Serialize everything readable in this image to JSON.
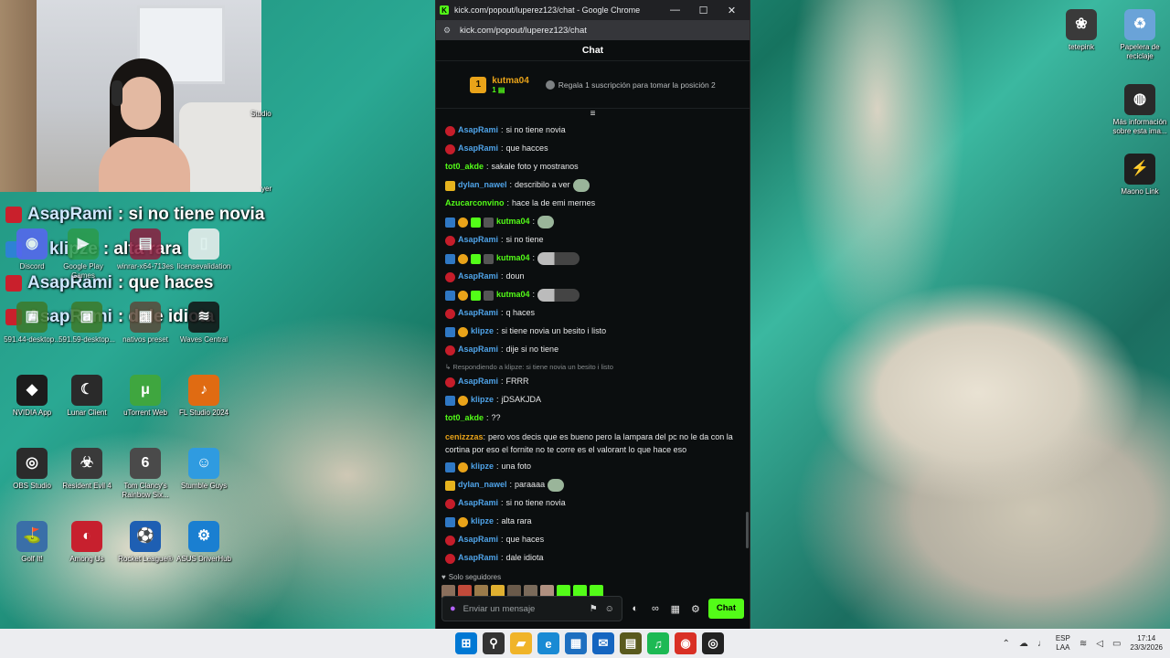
{
  "webcam": {
    "alt": "webcam"
  },
  "overlay_chat": [
    {
      "user": "AsapRami",
      "text": ": si no tiene novia",
      "badge": "red"
    },
    {
      "user": "klipze",
      "text": ": alta rara",
      "badge": "blue"
    },
    {
      "user": "AsapRami",
      "text": ": que haces",
      "badge": "red"
    },
    {
      "user": "AsapRami",
      "text": ": dale idiota",
      "badge": "red"
    }
  ],
  "desktop_icons_left": [
    {
      "label": "Discord",
      "color": "#5865f2",
      "glyph": "◉"
    },
    {
      "label": "Google Play Games",
      "color": "#2b9a4a",
      "glyph": "▶"
    },
    {
      "label": "winrar-x64-713es",
      "color": "#8b1e3f",
      "glyph": "▤"
    },
    {
      "label": "licensevalidation",
      "color": "#f1f1f1",
      "glyph": "▯"
    },
    {
      "label": "591.44-desktop...",
      "color": "#3d7a2a",
      "glyph": "▣"
    },
    {
      "label": "591.59-desktop...",
      "color": "#3d7a2a",
      "glyph": "▣"
    },
    {
      "label": "nativos preset",
      "color": "#5b4a3a",
      "glyph": "▦"
    },
    {
      "label": "Waves Central",
      "color": "#111111",
      "glyph": "≋"
    },
    {
      "label": "NVIDIA App",
      "color": "#1c1c1c",
      "glyph": "◆"
    },
    {
      "label": "Lunar Client",
      "color": "#2a2a2a",
      "glyph": "☾"
    },
    {
      "label": "uTorrent Web",
      "color": "#3fa63f",
      "glyph": "μ"
    },
    {
      "label": "FL Studio 2024",
      "color": "#e06b12",
      "glyph": "♪"
    },
    {
      "label": "OBS Studio",
      "color": "#2b2b2b",
      "glyph": "◎"
    },
    {
      "label": "Resident Evil 4",
      "color": "#3a3a3a",
      "glyph": "☣"
    },
    {
      "label": "Tom Clancy's Rainbow Six...",
      "color": "#4a4a4a",
      "glyph": "6"
    },
    {
      "label": "Stumble Guys",
      "color": "#2f9be0",
      "glyph": "☺"
    },
    {
      "label": "Golf It!",
      "color": "#3a6fa8",
      "glyph": "⛳"
    },
    {
      "label": "Among Us",
      "color": "#c7202e",
      "glyph": "◐"
    },
    {
      "label": "Rocket League®",
      "color": "#1e5fb3",
      "glyph": "⚽"
    },
    {
      "label": "ASUS DriverHub",
      "color": "#1a7fd1",
      "glyph": "⚙"
    }
  ],
  "desktop_partial": [
    {
      "label": "Studio"
    },
    {
      "label": "yer"
    }
  ],
  "desktop_icons_right": [
    {
      "label": "tetepink",
      "color": "#3a3a3a",
      "glyph": "❀"
    },
    {
      "label": "Papelera de reciclaje",
      "color": "#6aa3d8",
      "glyph": "♻"
    },
    {
      "label": "Más información sobre esta ima...",
      "color": "#2a2a2a",
      "glyph": "◍"
    },
    {
      "label": "Maono Link",
      "color": "#1f1f1f",
      "glyph": "⚡"
    }
  ],
  "browser": {
    "title": "kick.com/popout/luperez123/chat - Google Chrome",
    "url": "kick.com/popout/luperez123/chat",
    "minimize": "—",
    "maximize": "☐",
    "close": "✕"
  },
  "chat": {
    "header": "Chat",
    "pinned": {
      "rank": "1",
      "user": "kutma04",
      "sub": "1 ▤",
      "gift_text": "Regala 1 suscripción para tomar la posición 2"
    },
    "toggle": "≡",
    "reply_note": "↳ Respondiendo a klipze: si tiene novia un besito i listo",
    "messages": [
      {
        "badges": [
          "redcircle"
        ],
        "user": "AsapRami",
        "color": "#4fa3e8",
        "text": "si no tiene novia"
      },
      {
        "badges": [
          "redcircle"
        ],
        "user": "AsapRami",
        "color": "#4fa3e8",
        "text": "que hacces"
      },
      {
        "badges": [],
        "user": "tot0_akde",
        "color": "#53fc18",
        "text": "sakale foto y mostranos"
      },
      {
        "badges": [
          "crown"
        ],
        "user": "dylan_nawel",
        "color": "#4fa3e8",
        "text": "describilo a ver",
        "emote": "face"
      },
      {
        "badges": [],
        "user": "Azucarconvino",
        "color": "#53fc18",
        "text": "hace la de emi mernes"
      },
      {
        "badges": [
          "blue",
          "orange",
          "green",
          "gray"
        ],
        "user": "kutma04",
        "color": "#53fc18",
        "text": "",
        "emote": "face"
      },
      {
        "badges": [
          "redcircle"
        ],
        "user": "AsapRami",
        "color": "#4fa3e8",
        "text": "si no tiene"
      },
      {
        "badges": [
          "blue",
          "orange",
          "green",
          "gray"
        ],
        "user": "kutma04",
        "color": "#53fc18",
        "text": "",
        "emote": "wide"
      },
      {
        "badges": [
          "redcircle"
        ],
        "user": "AsapRami",
        "color": "#4fa3e8",
        "text": "doun"
      },
      {
        "badges": [
          "blue",
          "orange",
          "green",
          "gray"
        ],
        "user": "kutma04",
        "color": "#53fc18",
        "text": "",
        "emote": "wide"
      },
      {
        "badges": [
          "redcircle"
        ],
        "user": "AsapRami",
        "color": "#4fa3e8",
        "text": "q haces"
      },
      {
        "badges": [
          "blue",
          "orange"
        ],
        "user": "klipze",
        "color": "#4fa3e8",
        "text": "si tiene novia un besito i listo"
      },
      {
        "badges": [
          "redcircle"
        ],
        "user": "AsapRami",
        "color": "#4fa3e8",
        "text": "dije si no tiene"
      }
    ],
    "messages_after_reply": [
      {
        "badges": [
          "redcircle"
        ],
        "user": "AsapRami",
        "color": "#4fa3e8",
        "text": "FRRR"
      },
      {
        "badges": [
          "blue",
          "orange"
        ],
        "user": "klipze",
        "color": "#4fa3e8",
        "text": "jDSAKJDA"
      },
      {
        "badges": [],
        "user": "tot0_akde",
        "color": "#53fc18",
        "text": "??"
      },
      {
        "badges": [],
        "user": "cenizzzas",
        "color": "#e9a319",
        "text": "pero vos decis que es bueno pero la lampara del pc no le da con la cortina por eso el fornite no te corre es el valorant lo que hace eso",
        "multi": true
      },
      {
        "badges": [
          "blue",
          "orange"
        ],
        "user": "klipze",
        "color": "#4fa3e8",
        "text": "una foto"
      },
      {
        "badges": [
          "crown"
        ],
        "user": "dylan_nawel",
        "color": "#4fa3e8",
        "text": "paraaaa",
        "emote": "face"
      },
      {
        "badges": [
          "redcircle"
        ],
        "user": "AsapRami",
        "color": "#4fa3e8",
        "text": "si no tiene novia"
      },
      {
        "badges": [
          "blue",
          "orange"
        ],
        "user": "klipze",
        "color": "#4fa3e8",
        "text": "alta rara"
      },
      {
        "badges": [
          "redcircle"
        ],
        "user": "AsapRami",
        "color": "#4fa3e8",
        "text": "que haces"
      },
      {
        "badges": [
          "redcircle"
        ],
        "user": "AsapRami",
        "color": "#4fa3e8",
        "text": "dale idiota"
      }
    ],
    "followers_label": "Solo seguidores",
    "followers_avatar_colors": [
      "#8a6f5c",
      "#c14a3a",
      "#9b7b4a",
      "#e0b030",
      "#6a5a4a",
      "#7a6a5a",
      "#b09080",
      "#53fc18",
      "#53fc18",
      "#53fc18"
    ],
    "composer": {
      "placeholder": "Enviar un mensaje",
      "send_label": "Chat"
    }
  },
  "taskbar": {
    "apps": [
      {
        "name": "start",
        "glyph": "⊞",
        "color": "#0078d4"
      },
      {
        "name": "search",
        "glyph": "⚲",
        "color": "#333333"
      },
      {
        "name": "explorer",
        "glyph": "▰",
        "color": "#f0b429"
      },
      {
        "name": "edge",
        "glyph": "e",
        "color": "#1a8ad4"
      },
      {
        "name": "store",
        "glyph": "▦",
        "color": "#1e6fc0"
      },
      {
        "name": "outlook",
        "glyph": "✉",
        "color": "#1565c0"
      },
      {
        "name": "app-box",
        "glyph": "▤",
        "color": "#5a5a1e"
      },
      {
        "name": "spotify",
        "glyph": "♫",
        "color": "#1db954"
      },
      {
        "name": "chrome",
        "glyph": "◉",
        "color": "#d93025"
      },
      {
        "name": "obs",
        "glyph": "◎",
        "color": "#222222"
      }
    ],
    "lang_top": "ESP",
    "lang_bottom": "LAA",
    "time": "17:14",
    "date": "23/3/2026"
  }
}
